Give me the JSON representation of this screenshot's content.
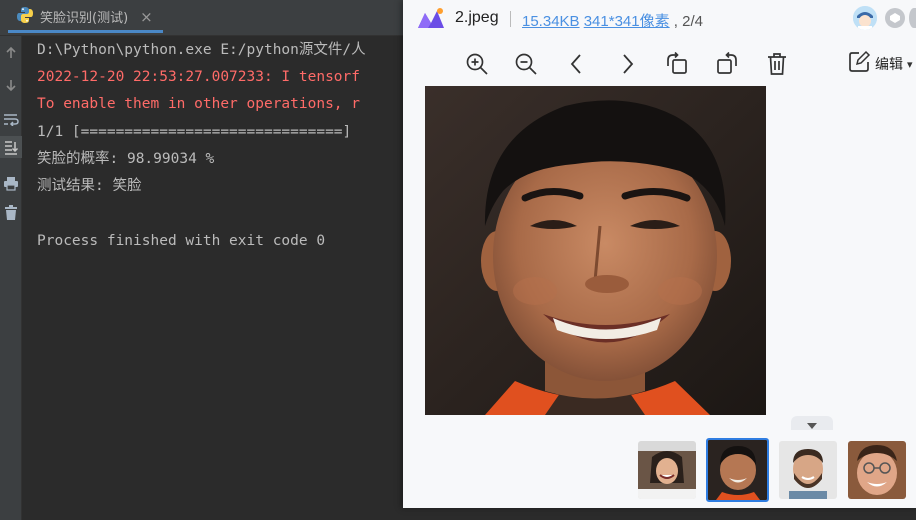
{
  "ide": {
    "run_tab": {
      "label": "笑脸识别(测试)",
      "close": "×"
    },
    "console_lines": [
      {
        "text": "D:\\Python\\python.exe E:/python源文件/人",
        "kind": "normal"
      },
      {
        "text": "2022-12-20 22:53:27.007233: I tensorf",
        "kind": "error"
      },
      {
        "text": "To enable them in other operations, r",
        "kind": "error"
      },
      {
        "text": "1/1 [==============================]",
        "kind": "normal"
      },
      {
        "text": "笑脸的概率: 98.99034 %",
        "kind": "normal"
      },
      {
        "text": "测试结果: 笑脸",
        "kind": "normal"
      },
      {
        "text": "",
        "kind": "normal"
      },
      {
        "text": "Process finished with exit code 0",
        "kind": "normal"
      }
    ],
    "tools": [
      "arrow-up-icon",
      "arrow-down-icon",
      "soft-wrap-icon",
      "scroll-to-end-icon",
      "print-icon",
      "trash-icon"
    ]
  },
  "viewer": {
    "file_name": "2.jpeg",
    "file_size": "15.34KB",
    "dimensions": "341*341像素",
    "page_indicator": ", 2/4",
    "edit_label": "编辑",
    "toolbar_icons": [
      "zoom-in-icon",
      "zoom-out-icon",
      "previous-icon",
      "next-icon",
      "rotate-left-icon",
      "rotate-right-icon",
      "delete-icon"
    ],
    "thumbnails": [
      "girl-smiling",
      "boy-smiling",
      "man-bearded",
      "man-glasses"
    ],
    "active_thumbnail": 1,
    "colors": {
      "accent": "#2f7de1",
      "link": "#4a90e2",
      "error": "#ff6b68",
      "console_text": "#bbbbbb"
    }
  }
}
